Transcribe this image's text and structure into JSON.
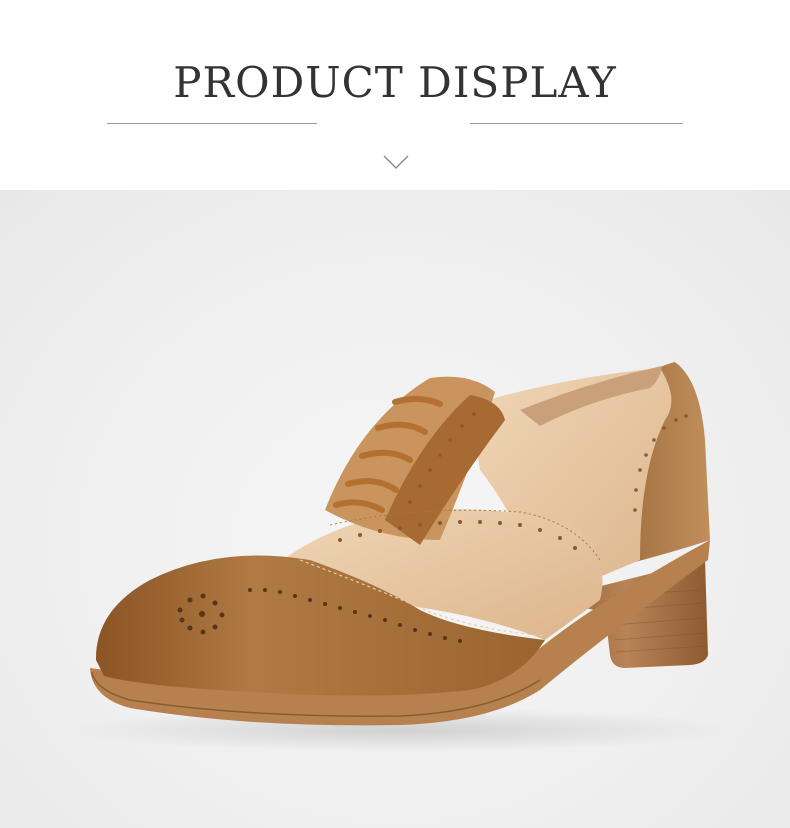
{
  "header": {
    "title": "PRODUCT DISPLAY"
  },
  "icons": {
    "divider": "chevron-down-icon"
  },
  "colors": {
    "title_text": "#333333",
    "rule": "#9a9a9a",
    "photo_background": "#efefef",
    "leather_brown": "#a66a32",
    "leather_beige": "#e9c9a6",
    "sole": "#b7804f"
  }
}
